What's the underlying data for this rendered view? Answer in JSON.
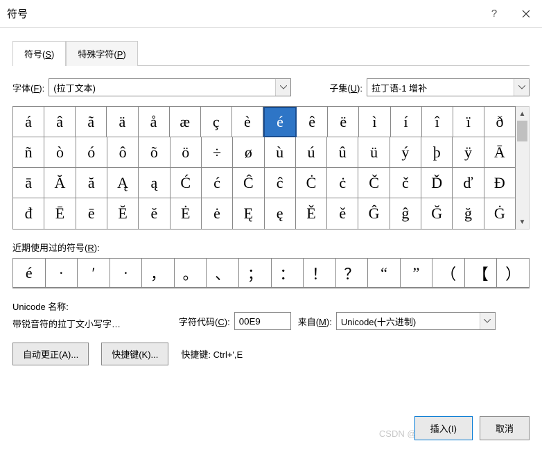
{
  "window": {
    "title": "符号"
  },
  "tabs": {
    "symbol": {
      "pre": "符号(",
      "u": "S",
      "post": ")"
    },
    "special": {
      "pre": "特殊字符(",
      "u": "P",
      "post": ")"
    }
  },
  "font": {
    "label_pre": "字体(",
    "label_u": "F",
    "label_post": "):",
    "value": "(拉丁文本)"
  },
  "subset": {
    "label_pre": "子集(",
    "label_u": "U",
    "label_post": "):",
    "value": "拉丁语-1 增补"
  },
  "grid": {
    "rows": [
      [
        "á",
        "â",
        "ã",
        "ä",
        "å",
        "æ",
        "ç",
        "è",
        "é",
        "ê",
        "ë",
        "ì",
        "í",
        "î",
        "ï",
        "ð"
      ],
      [
        "ñ",
        "ò",
        "ó",
        "ô",
        "õ",
        "ö",
        "÷",
        "ø",
        "ù",
        "ú",
        "û",
        "ü",
        "ý",
        "þ",
        "ÿ",
        "Ā"
      ],
      [
        "ā",
        "Ă",
        "ă",
        "Ą",
        "ą",
        "Ć",
        "ć",
        "Ĉ",
        "ĉ",
        "Ċ",
        "ċ",
        "Č",
        "č",
        "Ď",
        "ď",
        "Đ"
      ],
      [
        "đ",
        "Ē",
        "ē",
        "Ĕ",
        "ĕ",
        "Ė",
        "ė",
        "Ę",
        "ę",
        "Ě",
        "ě",
        "Ĝ",
        "ĝ",
        "Ğ",
        "ğ",
        "Ġ"
      ]
    ],
    "selected_row": 0,
    "selected_col": 8
  },
  "recent": {
    "label_pre": "近期使用过的符号(",
    "label_u": "R",
    "label_post": "):",
    "items": [
      "é",
      "·",
      "′",
      "·",
      "，",
      "。",
      "、",
      "；",
      "：",
      "！",
      "？",
      "“",
      "”",
      "（",
      "【",
      "）"
    ]
  },
  "unicode": {
    "name_label": "Unicode 名称:",
    "desc": "带锐音符的拉丁文小写字…",
    "code_label_pre": "字符代码(",
    "code_label_u": "C",
    "code_label_post": "):",
    "code_value": "00E9",
    "from_label_pre": "来自(",
    "from_label_u": "M",
    "from_label_post": "):",
    "from_value": "Unicode(十六进制)"
  },
  "buttons": {
    "autocorrect_pre": "自动更正(",
    "autocorrect_u": "A",
    "autocorrect_post": ")...",
    "shortcut_pre": "快捷键(",
    "shortcut_u": "K",
    "shortcut_post": ")...",
    "shortcut_label": "快捷键:",
    "shortcut_value": "Ctrl+',E",
    "insert_pre": "插入(",
    "insert_u": "I",
    "insert_post": ")",
    "cancel": "取消"
  },
  "watermark": "CSDN @helloflashy"
}
